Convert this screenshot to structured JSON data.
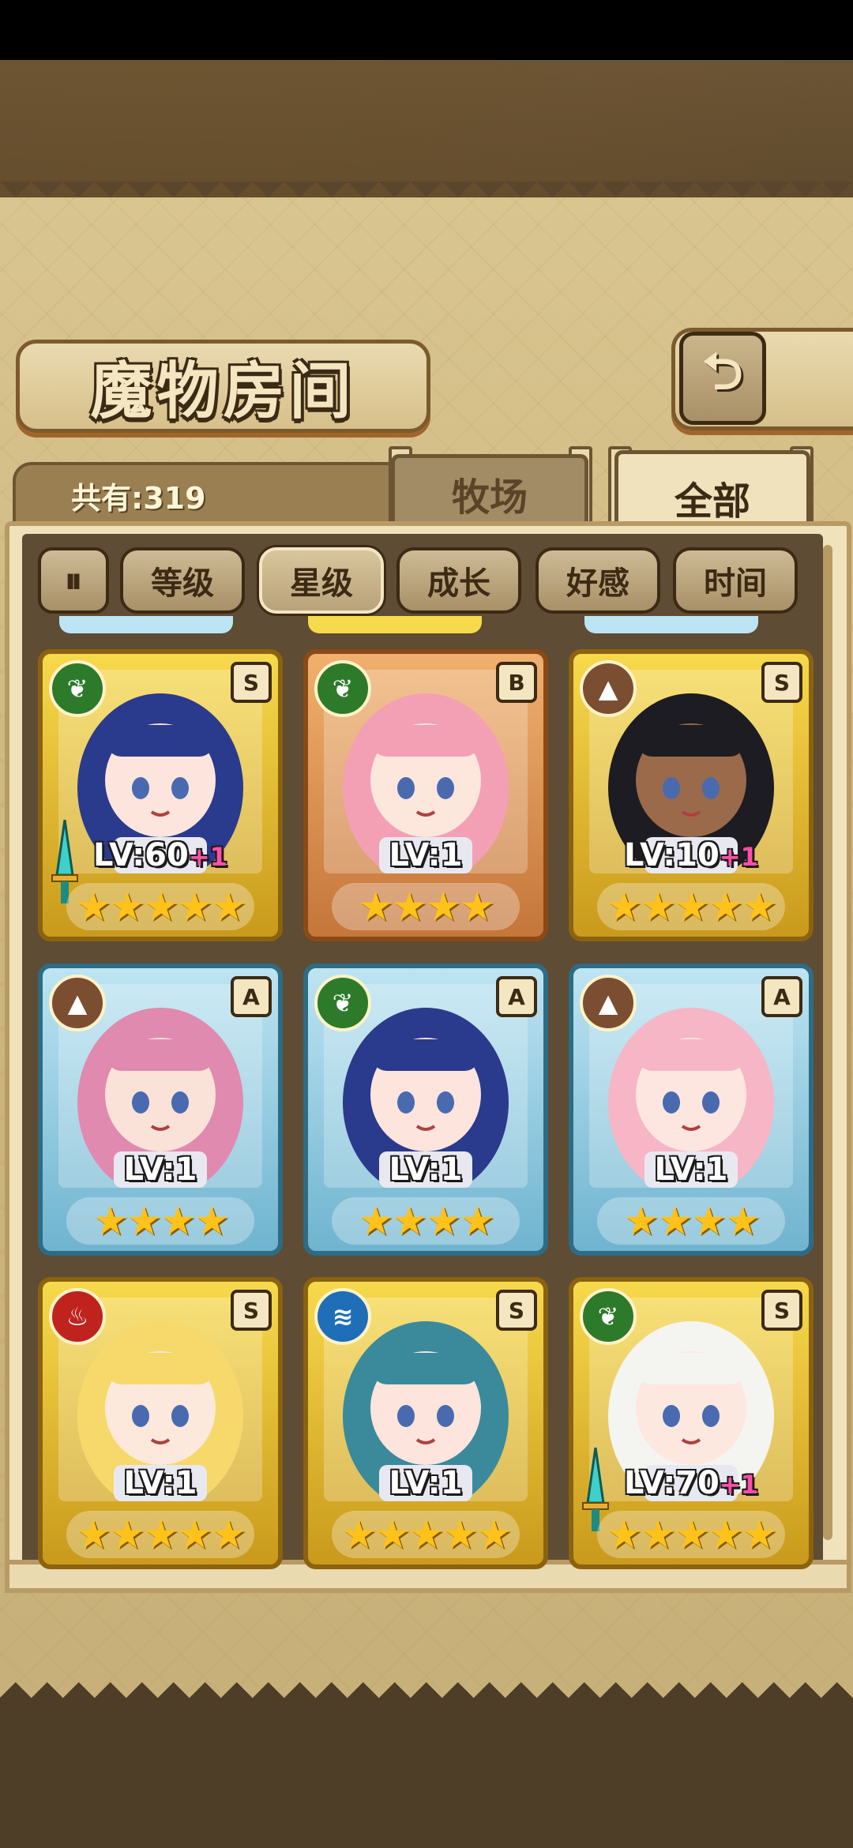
{
  "header": {
    "title": "魔物房间",
    "back_icon": "return-arrow-icon",
    "back_glyph": "⮌"
  },
  "summary": {
    "count_label": "共有:319"
  },
  "tabs": [
    {
      "label": "牧场",
      "selected": false
    },
    {
      "label": "全部",
      "selected": true
    }
  ],
  "sort": {
    "toggle_glyph": "⏸",
    "options": [
      {
        "label": "等级",
        "active": false
      },
      {
        "label": "星级",
        "active": true
      },
      {
        "label": "成长",
        "active": false
      },
      {
        "label": "好感",
        "active": false
      },
      {
        "label": "时间",
        "active": false
      }
    ]
  },
  "monsters": [
    {
      "element": "nature",
      "rank": "S",
      "level": "LV:60",
      "plus": "+1",
      "stars": 5,
      "frame": "gold",
      "equip": true,
      "hair": "#2a3a8c",
      "skin": "#fde4dc"
    },
    {
      "element": "nature",
      "rank": "B",
      "level": "LV:1",
      "plus": "",
      "stars": 4,
      "frame": "bronze",
      "equip": false,
      "hair": "#f3a0b4",
      "skin": "#fde6dc"
    },
    {
      "element": "earth",
      "rank": "S",
      "level": "LV:10",
      "plus": "+1",
      "stars": 5,
      "frame": "gold",
      "equip": false,
      "hair": "#1c1c22",
      "skin": "#9a6a4a"
    },
    {
      "element": "earth",
      "rank": "A",
      "level": "LV:1",
      "plus": "",
      "stars": 4,
      "frame": "blue",
      "equip": false,
      "hair": "#e08ab0",
      "skin": "#fbe2d8"
    },
    {
      "element": "nature",
      "rank": "A",
      "level": "LV:1",
      "plus": "",
      "stars": 4,
      "frame": "blue",
      "equip": false,
      "hair": "#2a3a8c",
      "skin": "#fde4dc"
    },
    {
      "element": "earth",
      "rank": "A",
      "level": "LV:1",
      "plus": "",
      "stars": 4,
      "frame": "blue",
      "equip": false,
      "hair": "#f6b6c6",
      "skin": "#fde6e0"
    },
    {
      "element": "fire",
      "rank": "S",
      "level": "LV:1",
      "plus": "",
      "stars": 5,
      "frame": "gold",
      "equip": false,
      "hair": "#f7d86a",
      "skin": "#fde8dc"
    },
    {
      "element": "water",
      "rank": "S",
      "level": "LV:1",
      "plus": "",
      "stars": 5,
      "frame": "gold",
      "equip": false,
      "hair": "#3a8a9c",
      "skin": "#fde4dc"
    },
    {
      "element": "nature",
      "rank": "S",
      "level": "LV:70",
      "plus": "+1",
      "stars": 5,
      "frame": "gold",
      "equip": true,
      "hair": "#f4f4f0",
      "skin": "#fde8e0"
    }
  ],
  "element_glyphs": {
    "nature": "❦",
    "earth": "▲",
    "fire": "♨",
    "water": "≋"
  },
  "star_glyph": "★"
}
